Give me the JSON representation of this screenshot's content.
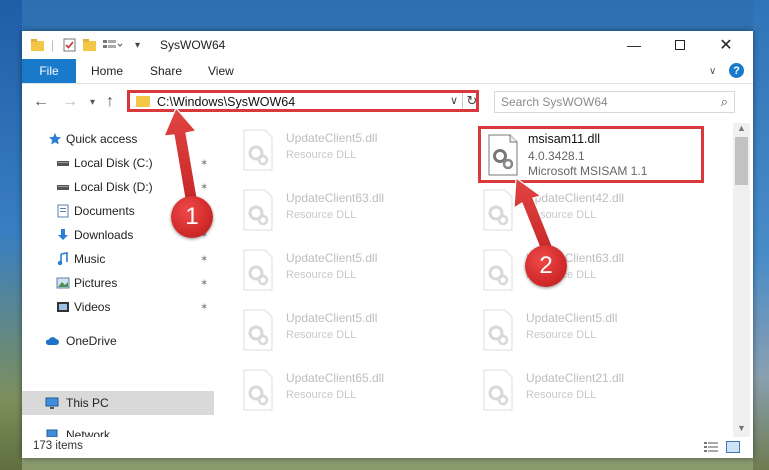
{
  "window": {
    "title": "SysWOW64"
  },
  "ribbon": {
    "file": "File",
    "home": "Home",
    "share": "Share",
    "view": "View",
    "help": "?"
  },
  "address": {
    "path": "C:\\Windows\\SysWOW64"
  },
  "search": {
    "placeholder": "Search SysWOW64"
  },
  "sidebar": {
    "items": [
      {
        "label": "Quick access",
        "icon": "star-icon",
        "pinned": false
      },
      {
        "label": "Local Disk (C:)",
        "icon": "drive-icon",
        "pinned": true
      },
      {
        "label": "Local Disk (D:)",
        "icon": "drive-icon",
        "pinned": true
      },
      {
        "label": "Documents",
        "icon": "documents-icon",
        "pinned": true
      },
      {
        "label": "Downloads",
        "icon": "download-icon",
        "pinned": true
      },
      {
        "label": "Music",
        "icon": "music-icon",
        "pinned": true
      },
      {
        "label": "Pictures",
        "icon": "pictures-icon",
        "pinned": true
      },
      {
        "label": "Videos",
        "icon": "videos-icon",
        "pinned": true
      },
      {
        "label": "OneDrive",
        "icon": "cloud-icon",
        "pinned": false
      },
      {
        "label": "This PC",
        "icon": "computer-icon",
        "pinned": false,
        "selected": true
      },
      {
        "label": "Network",
        "icon": "network-icon",
        "pinned": false
      }
    ]
  },
  "files": {
    "left": [
      {
        "name": "UpdateClient5.dll",
        "type": "Resource DLL"
      },
      {
        "name": "UpdateClient63.dll",
        "type": "Resource DLL"
      },
      {
        "name": "UpdateClient5.dll",
        "type": "Resource DLL"
      },
      {
        "name": "UpdateClient5.dll",
        "type": "Resource DLL"
      },
      {
        "name": "UpdateClient65.dll",
        "type": "Resource DLL"
      }
    ],
    "right": [
      {
        "name": "UpdateClient42.dll",
        "type": "Resource DLL"
      },
      {
        "name": "UpdateClient63.dll",
        "type": "Resource DLL"
      },
      {
        "name": "UpdateClient5.dll",
        "type": "Resource DLL"
      },
      {
        "name": "UpdateClient21.dll",
        "type": "Resource DLL"
      }
    ],
    "highlighted": {
      "name": "msisam11.dll",
      "version": "4.0.3428.1",
      "description": "Microsoft MSISAM 1.1"
    }
  },
  "status": {
    "count": "173 items"
  },
  "callouts": {
    "one": "1",
    "two": "2"
  },
  "colors": {
    "accent": "#1979ca",
    "highlight": "#d9393c",
    "folder": "#f3c646"
  }
}
